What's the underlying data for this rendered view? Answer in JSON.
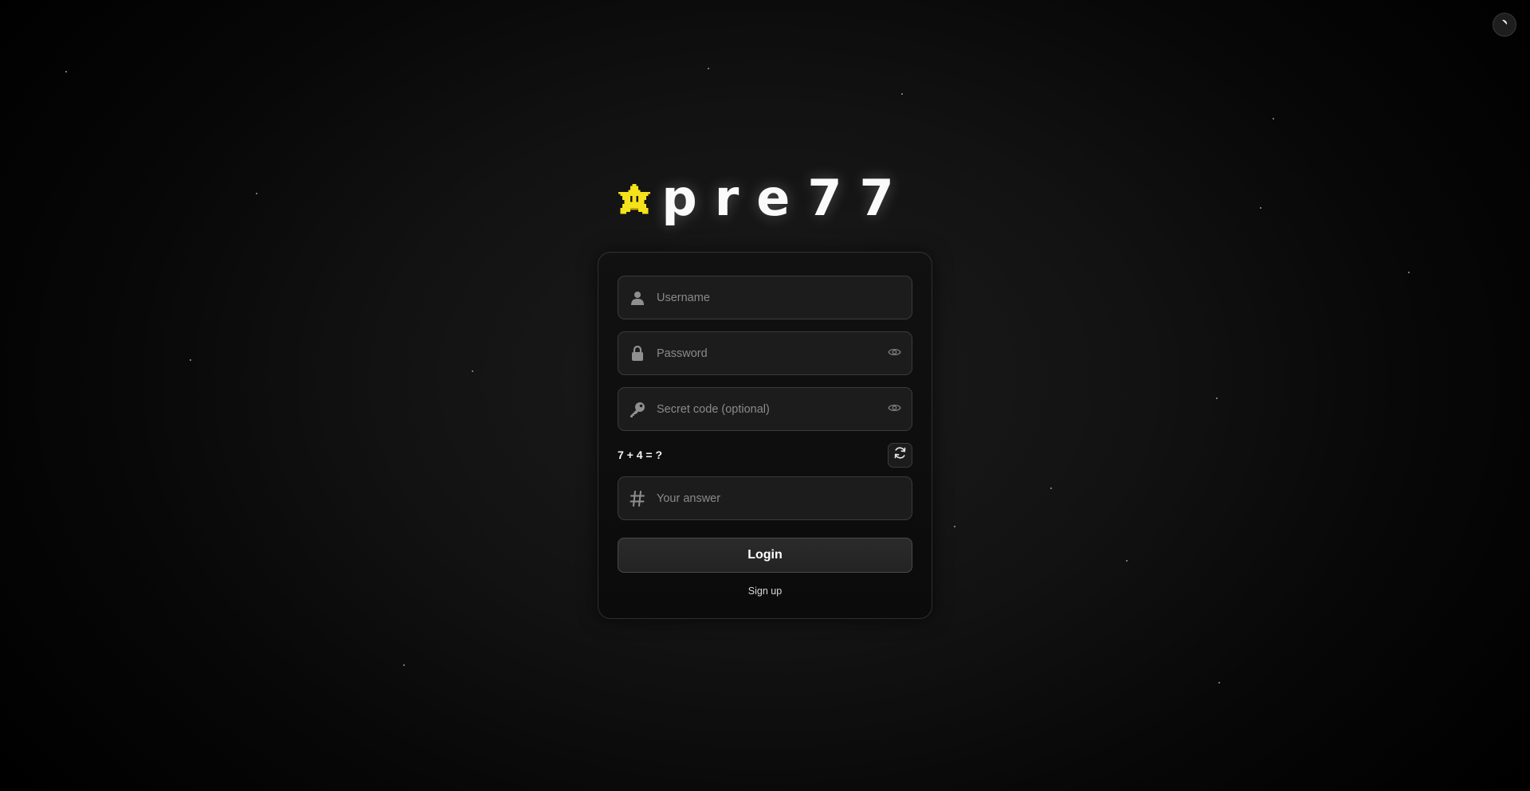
{
  "brand": {
    "name": "pre77",
    "icon": "pixel-star-icon",
    "accent_color": "#f5e21c"
  },
  "theme_toggle": {
    "icon": "theme-toggle-icon"
  },
  "form": {
    "username": {
      "placeholder": "Username",
      "value": "",
      "icon": "user-icon"
    },
    "password": {
      "placeholder": "Password",
      "value": "",
      "icon": "lock-icon",
      "toggle_icon": "eye-icon"
    },
    "secret_code": {
      "placeholder": "Secret code (optional)",
      "value": "",
      "icon": "key-icon",
      "toggle_icon": "eye-icon"
    },
    "captcha": {
      "question": "7 + 4 = ?",
      "refresh_icon": "refresh-icon"
    },
    "answer": {
      "placeholder": "Your answer",
      "value": "",
      "icon": "hash-icon"
    },
    "login_label": "Login",
    "signup_label": "Sign up"
  },
  "colors": {
    "background": "#000000",
    "card_border": "#2e2e2e",
    "field_background": "#1c1c1c",
    "text": "#ffffff"
  }
}
